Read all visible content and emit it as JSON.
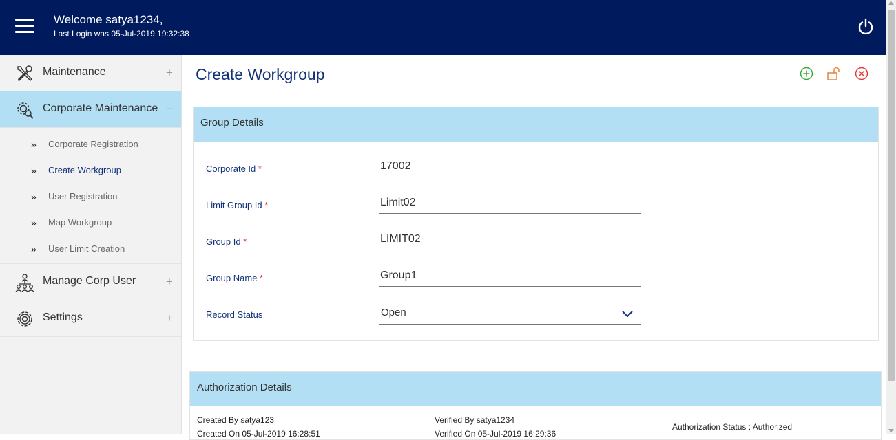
{
  "header": {
    "welcome": "Welcome satya1234,",
    "last_login": "Last Login was 05-Jul-2019 19:32:38"
  },
  "sidebar": {
    "items": [
      {
        "label": "Maintenance",
        "toggle": "+",
        "icon": "tools-icon"
      },
      {
        "label": "Corporate Maintenance",
        "toggle": "−",
        "icon": "gear-search-icon"
      },
      {
        "label": "Manage Corp User",
        "toggle": "+",
        "icon": "org-chart-icon"
      },
      {
        "label": "Settings",
        "toggle": "+",
        "icon": "gear-icon"
      }
    ],
    "submenu": [
      {
        "label": "Corporate Registration"
      },
      {
        "label": "Create Workgroup"
      },
      {
        "label": "User Registration"
      },
      {
        "label": "Map Workgroup"
      },
      {
        "label": "User Limit Creation"
      }
    ],
    "chevron": "»"
  },
  "page": {
    "title": "Create Workgroup",
    "actions": [
      "add-icon",
      "unlock-icon",
      "close-icon"
    ]
  },
  "group_details": {
    "heading": "Group Details",
    "required_mark": "*",
    "fields": [
      {
        "label": "Corporate Id",
        "value": "17002"
      },
      {
        "label": "Limit Group Id",
        "value": "Limit02"
      },
      {
        "label": "Group Id",
        "value": "LIMIT02"
      },
      {
        "label": "Group Name",
        "value": "Group1"
      }
    ],
    "record_status": {
      "label": "Record Status",
      "value": "Open"
    }
  },
  "authorization": {
    "heading": "Authorization Details",
    "created_by": "Created By satya123",
    "created_on": "Created On 05-Jul-2019 16:28:51",
    "verified_by": "Verified By satya1234",
    "verified_on": "Verified On 05-Jul-2019 16:29:36",
    "status": "Authorization Status : Authorized"
  },
  "colors": {
    "header_bg": "#001a5e",
    "accent_light": "#b3dff5",
    "title": "#11327a",
    "add": "#39a935",
    "unlock": "#e8833a",
    "close": "#e53935"
  }
}
